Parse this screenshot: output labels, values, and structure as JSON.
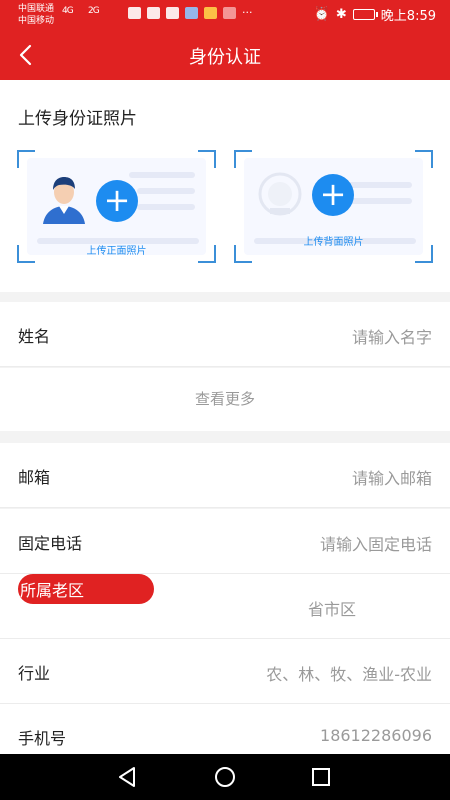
{
  "status_bar": {
    "carrier1": "中国联通",
    "carrier2": "中国移动",
    "net1": "4G",
    "net2": "2G",
    "more": "···",
    "time": "晚上8:59"
  },
  "header": {
    "title": "身份认证"
  },
  "upload": {
    "title": "上传身份证照片",
    "front_label": "上传正面照片",
    "back_label": "上传背面照片"
  },
  "form": {
    "name": {
      "label": "姓名",
      "placeholder": "请输入名字"
    },
    "more": "查看更多",
    "email": {
      "label": "邮箱",
      "placeholder": "请输入邮箱"
    },
    "phone": {
      "label": "固定电话",
      "placeholder": "请输入固定电话"
    },
    "district": {
      "label": "所属老区",
      "value": "省市区"
    },
    "industry": {
      "label": "行业",
      "value": "农、林、牧、渔业-农业"
    },
    "mobile": {
      "label": "手机号",
      "value": "18612286096"
    }
  },
  "colors": {
    "accent": "#e02222",
    "blue": "#1d8cf0"
  }
}
